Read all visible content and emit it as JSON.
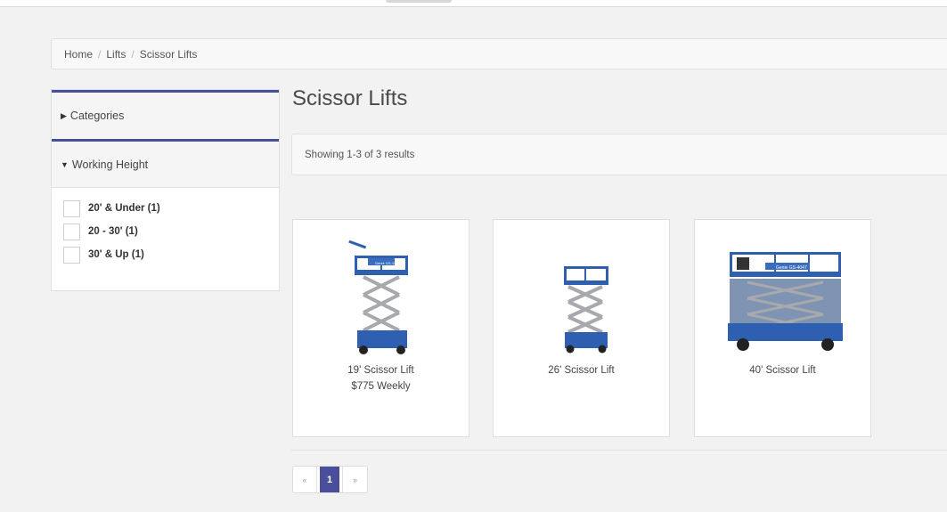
{
  "breadcrumb": {
    "items": [
      "Home",
      "Lifts",
      "Scissor Lifts"
    ],
    "separator": "/"
  },
  "sidebar": {
    "categories_label": "Categories",
    "working_height_label": "Working Height",
    "filters": [
      {
        "label": "20' & Under (1)"
      },
      {
        "label": "20 - 30' (1)"
      },
      {
        "label": "30' & Up (1)"
      }
    ]
  },
  "page": {
    "title": "Scissor Lifts",
    "results_text": "Showing 1-3 of 3 results"
  },
  "products": [
    {
      "name": "19' Scissor Lift",
      "price": "$775 Weekly",
      "image_label": "Genie GS-1930"
    },
    {
      "name": "26' Scissor Lift",
      "price": "",
      "image_label": ""
    },
    {
      "name": "40' Scissor Lift",
      "price": "",
      "image_label": "Genie GS-4047"
    }
  ],
  "pagination": {
    "prev": "«",
    "current": "1",
    "next": "»"
  },
  "colors": {
    "accent": "#4a4f9b",
    "lift_blue": "#2f5fb0",
    "scissor_grey": "#a7a9ad"
  }
}
